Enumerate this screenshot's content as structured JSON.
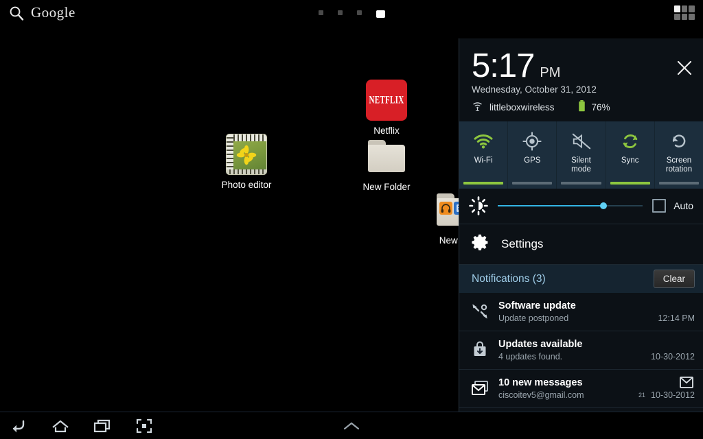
{
  "homescreen": {
    "search": {
      "label": "Google",
      "icon": "search-icon"
    },
    "page_indicator": {
      "total": 4,
      "active": 4
    },
    "apps_button_icon": "apps-grid-icon",
    "icons": [
      {
        "name": "Photo editor",
        "type": "app"
      },
      {
        "name": "Netflix",
        "type": "app",
        "wordmark": "NETFLIX",
        "color": "#d81f26"
      },
      {
        "name": "New Folder",
        "type": "folder"
      },
      {
        "name": "New Fo",
        "type": "folder"
      }
    ]
  },
  "panel": {
    "clock": {
      "time": "5:17",
      "ampm": "PM",
      "date": "Wednesday, October 31, 2012"
    },
    "close_icon": "close-icon",
    "status": {
      "wifi_icon": "wifi-icon",
      "wifi_ssid": "littleboxwireless",
      "battery_icon": "battery-icon",
      "battery_level": "76%"
    },
    "toggles": [
      {
        "label": "Wi-Fi",
        "icon": "wifi-icon",
        "state": "on"
      },
      {
        "label": "GPS",
        "icon": "gps-icon",
        "state": "off"
      },
      {
        "label": "Silent\nmode",
        "icon": "mute-icon",
        "state": "off"
      },
      {
        "label": "Sync",
        "icon": "sync-icon",
        "state": "on"
      },
      {
        "label": "Screen\nrotation",
        "icon": "screen-rotation-icon",
        "state": "off"
      }
    ],
    "brightness": {
      "icon": "brightness-icon",
      "value_percent": 73,
      "auto_label": "Auto",
      "auto_checked": false
    },
    "settings": {
      "label": "Settings",
      "icon": "gear-icon"
    },
    "notifications_header": {
      "title": "Notifications (3)",
      "clear_label": "Clear"
    },
    "notifications": [
      {
        "icon": "software-update-icon",
        "title": "Software update",
        "subtitle": "Update postponed",
        "time": "12:14 PM"
      },
      {
        "icon": "updates-available-icon",
        "title": "Updates available",
        "subtitle": "4 updates found.",
        "time": "10-30-2012"
      },
      {
        "icon": "gmail-icon",
        "title": "10 new messages",
        "subtitle": "ciscoitev5@gmail.com",
        "time": "10-30-2012",
        "badge": "21"
      }
    ]
  },
  "system_bar": {
    "buttons": [
      {
        "name": "back-button",
        "icon": "back-arrow-icon"
      },
      {
        "name": "home-button",
        "icon": "home-icon"
      },
      {
        "name": "recent-apps-button",
        "icon": "recent-apps-icon"
      },
      {
        "name": "screenshot-button",
        "icon": "screen-capture-icon"
      }
    ],
    "center_icon": "chevron-up-icon"
  },
  "colors": {
    "accent_green": "#8dc63f",
    "accent_blue": "#33b5e5",
    "panel_bg": "#0c1116",
    "toggle_bg": "#1c2e3d",
    "notif_header_bg": "#152430"
  }
}
